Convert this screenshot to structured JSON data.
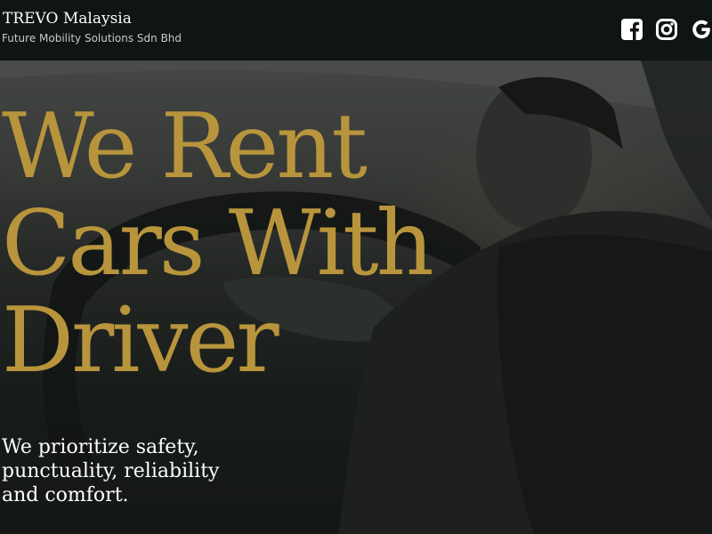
{
  "header": {
    "title": "TREVO Malaysia",
    "tagline": "Future Mobility Solutions Sdn Bhd",
    "social": [
      {
        "icon": "facebook-square-icon"
      },
      {
        "icon": "instagram-icon"
      },
      {
        "icon": "google-icon"
      }
    ]
  },
  "hero": {
    "headline_lines": [
      "We Rent",
      "Cars With",
      "Driver"
    ],
    "subheadline_lines": [
      "We prioritize safety,",
      "punctuality, reliability",
      "and comfort."
    ],
    "background_image": "person-driving-car-photo"
  },
  "colors": {
    "header_bg": "#0f1512",
    "headline": "#b8953c",
    "subheadline": "#ffffff"
  }
}
